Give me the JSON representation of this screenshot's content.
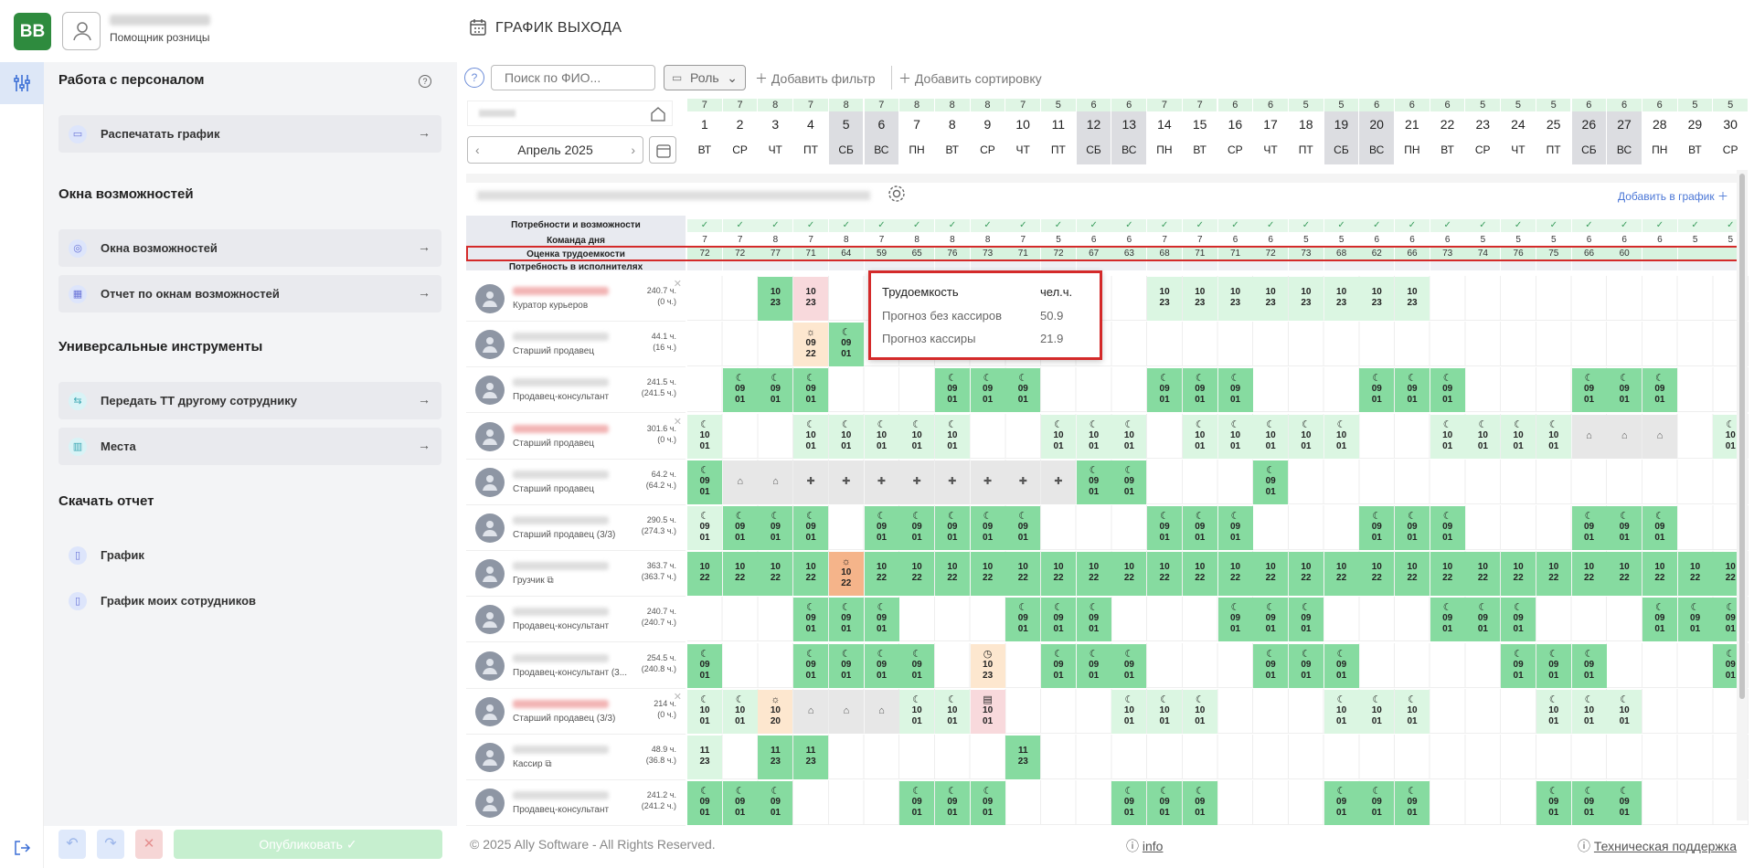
{
  "header": {
    "logo": "BB",
    "user_role": "Помощник розницы",
    "page_title": "ГРАФИК ВЫХОДА"
  },
  "sidebar": {
    "s1_title": "Работа с персоналом",
    "print": "Распечатать график",
    "s2_title": "Окна возможностей",
    "win1": "Окна возможностей",
    "win2": "Отчет по окнам возможностей",
    "s3_title": "Универсальные инструменты",
    "uni1": "Передать ТТ другому сотруднику",
    "uni2": "Места",
    "s4_title": "Скачать отчет",
    "dl1": "График",
    "dl2": "График моих сотрудников"
  },
  "bottom": {
    "publish": "Опубликовать"
  },
  "toolbar": {
    "search_placeholder": "Поиск по ФИО...",
    "role": "Роль",
    "add_filter": "Добавить фильтр",
    "add_sort": "Добавить сортировку"
  },
  "month": "Апрель 2025",
  "add_to_chart": "Добавить в график",
  "days": [
    {
      "n": "1",
      "w": "ВТ",
      "c": "7",
      "we": false,
      "k": "7",
      "e": "72"
    },
    {
      "n": "2",
      "w": "СР",
      "c": "7",
      "we": false,
      "k": "7",
      "e": "72"
    },
    {
      "n": "3",
      "w": "ЧТ",
      "c": "8",
      "we": false,
      "k": "8",
      "e": "77"
    },
    {
      "n": "4",
      "w": "ПТ",
      "c": "7",
      "we": false,
      "k": "7",
      "e": "71"
    },
    {
      "n": "5",
      "w": "СБ",
      "c": "8",
      "we": true,
      "k": "8",
      "e": "64"
    },
    {
      "n": "6",
      "w": "ВС",
      "c": "7",
      "we": true,
      "k": "7",
      "e": "59"
    },
    {
      "n": "7",
      "w": "ПН",
      "c": "8",
      "we": false,
      "k": "8",
      "e": "65"
    },
    {
      "n": "8",
      "w": "ВТ",
      "c": "8",
      "we": false,
      "k": "8",
      "e": "76"
    },
    {
      "n": "9",
      "w": "СР",
      "c": "8",
      "we": false,
      "k": "8",
      "e": "73"
    },
    {
      "n": "10",
      "w": "ЧТ",
      "c": "7",
      "we": false,
      "k": "7",
      "e": "71"
    },
    {
      "n": "11",
      "w": "ПТ",
      "c": "5",
      "we": false,
      "k": "5",
      "e": "72"
    },
    {
      "n": "12",
      "w": "СБ",
      "c": "6",
      "we": true,
      "k": "6",
      "e": "67"
    },
    {
      "n": "13",
      "w": "ВС",
      "c": "6",
      "we": true,
      "k": "6",
      "e": "63"
    },
    {
      "n": "14",
      "w": "ПН",
      "c": "7",
      "we": false,
      "k": "7",
      "e": "68"
    },
    {
      "n": "15",
      "w": "ВТ",
      "c": "7",
      "we": false,
      "k": "7",
      "e": "71"
    },
    {
      "n": "16",
      "w": "СР",
      "c": "6",
      "we": false,
      "k": "6",
      "e": "71"
    },
    {
      "n": "17",
      "w": "ЧТ",
      "c": "6",
      "we": false,
      "k": "6",
      "e": "72"
    },
    {
      "n": "18",
      "w": "ПТ",
      "c": "5",
      "we": false,
      "k": "5",
      "e": "73"
    },
    {
      "n": "19",
      "w": "СБ",
      "c": "5",
      "we": true,
      "k": "5",
      "e": "68"
    },
    {
      "n": "20",
      "w": "ВС",
      "c": "6",
      "we": true,
      "k": "6",
      "e": "62"
    },
    {
      "n": "21",
      "w": "ПН",
      "c": "6",
      "we": false,
      "k": "6",
      "e": "66"
    },
    {
      "n": "22",
      "w": "ВТ",
      "c": "6",
      "we": false,
      "k": "6",
      "e": "73"
    },
    {
      "n": "23",
      "w": "СР",
      "c": "5",
      "we": false,
      "k": "5",
      "e": "74"
    },
    {
      "n": "24",
      "w": "ЧТ",
      "c": "5",
      "we": false,
      "k": "5",
      "e": "76"
    },
    {
      "n": "25",
      "w": "ПТ",
      "c": "5",
      "we": false,
      "k": "5",
      "e": "75"
    },
    {
      "n": "26",
      "w": "СБ",
      "c": "6",
      "we": true,
      "k": "6",
      "e": "66"
    },
    {
      "n": "27",
      "w": "ВС",
      "c": "6",
      "we": true,
      "k": "6",
      "e": "60"
    },
    {
      "n": "28",
      "w": "ПН",
      "c": "6",
      "we": false,
      "k": "6",
      "e": ""
    },
    {
      "n": "29",
      "w": "ВТ",
      "c": "5",
      "we": false,
      "k": "5",
      "e": ""
    },
    {
      "n": "30",
      "w": "СР",
      "c": "5",
      "we": false,
      "k": "5",
      "e": ""
    }
  ],
  "metrics": {
    "needs": "Потребности и возможности",
    "team": "Команда дня",
    "labor": "Оценка трудоемкости",
    "exec": "Потребность в исполнителях",
    "check": "✓"
  },
  "employees": [
    {
      "role": "Куратор курьеров",
      "h1": "240.7 ч.",
      "h2": "(0 ч.)",
      "red": true,
      "x": true
    },
    {
      "role": "Старший продавец",
      "h1": "44.1 ч.",
      "h2": "(16 ч.)",
      "red": false,
      "x": false
    },
    {
      "role": "Продавец-консультант",
      "h1": "241.5 ч.",
      "h2": "(241.5 ч.)",
      "red": false,
      "x": false
    },
    {
      "role": "Старший продавец",
      "h1": "301.6 ч.",
      "h2": "(0 ч.)",
      "red": true,
      "x": true
    },
    {
      "role": "Старший продавец",
      "h1": "64.2 ч.",
      "h2": "(64.2 ч.)",
      "red": false,
      "x": false
    },
    {
      "role": "Старший продавец (3/3)",
      "h1": "290.5 ч.",
      "h2": "(274.3 ч.)",
      "red": false,
      "x": false
    },
    {
      "role": "Грузчик ⧉",
      "h1": "363.7 ч.",
      "h2": "(363.7 ч.)",
      "red": false,
      "x": false
    },
    {
      "role": "Продавец-консультант",
      "h1": "240.7 ч.",
      "h2": "(240.7 ч.)",
      "red": false,
      "x": false
    },
    {
      "role": "Продавец-консультант (3...",
      "h1": "254.5 ч.",
      "h2": "(240.8 ч.)",
      "red": false,
      "x": false
    },
    {
      "role": "Старший продавец (3/3)",
      "h1": "214 ч.",
      "h2": "(0 ч.)",
      "red": true,
      "x": true
    },
    {
      "role": "Кассир ⧉",
      "h1": "48.9 ч.",
      "h2": "(36.8 ч.)",
      "red": false,
      "x": false
    },
    {
      "role": "Продавец-консультант",
      "h1": "241.2 ч.",
      "h2": "(241.2 ч.)",
      "red": false,
      "x": false
    }
  ],
  "schedule": [
    "..,..,g:10|23,pk:10|23,..,..,..,..,..,..,..,..,..,lg:10|23,lg:10|23,lg:10|23,lg:10|23,lg:10|23,lg:10|23,lg:10|23,lg:10|23,..,..,..,..,..,..,..,..,..",
    "..,..,..,pc:☼|09|22,g:☾|09|01,..,..,..,..,..,..,..,..,..,..,..,..,..,..,..,..,..,..,..,..,..,..,..,..,..",
    "..,g:☾|09|01,g:☾|09|01,g:☾|09|01,..,..,..,g:☾|09|01,g:☾|09|01,g:☾|09|01,..,..,..,g:☾|09|01,g:☾|09|01,g:☾|09|01,..,..,..,g:☾|09|01,g:☾|09|01,g:☾|09|01,..,..,..,g:☾|09|01,g:☾|09|01,g:☾|09|01,..,..",
    "lg:☾|10|01,..,..,lg:☾|10|01,lg:☾|10|01,lg:☾|10|01,lg:☾|10|01,lg:☾|10|01,..,..,lg:☾|10|01,lg:☾|10|01,lg:☾|10|01,..,lg:☾|10|01,lg:☾|10|01,lg:☾|10|01,lg:☾|10|01,lg:☾|10|01,..,..,lg:☾|10|01,lg:☾|10|01,lg:☾|10|01,lg:☾|10|01,gr:⌂,gr:⌂,gr:⌂,..,lg:☾|10|01",
    "g:☾|09|01,gr:⌂,gr:⌂,gr:✚,gr:✚,gr:✚,gr:✚,gr:✚,gr:✚,gr:✚,gr:✚,g:☾|09|01,g:☾|09|01,..,..,..,g:☾|09|01,..,..,..,..,..,..,..,..,..,..,..,..,..",
    "lg:☾|09|01,g:☾|09|01,g:☾|09|01,g:☾|09|01,..,g:☾|09|01,g:☾|09|01,g:☾|09|01,g:☾|09|01,g:☾|09|01,..,..,..,g:☾|09|01,g:☾|09|01,g:☾|09|01,..,..,..,g:☾|09|01,g:☾|09|01,g:☾|09|01,..,..,..,g:☾|09|01,g:☾|09|01,g:☾|09|01,..,..",
    "g:10|22,g:10|22,g:10|22,g:10|22,or:☼|10|22,g:10|22,g:10|22,g:10|22,g:10|22,g:10|22,g:10|22,g:10|22,g:10|22,g:10|22,g:10|22,g:10|22,g:10|22,g:10|22,g:10|22,g:10|22,g:10|22,g:10|22,g:10|22,g:10|22,g:10|22,g:10|22,g:10|22,g:10|22,g:10|22,g:10|22",
    "..,..,..,g:☾|09|01,g:☾|09|01,g:☾|09|01,..,..,..,g:☾|09|01,g:☾|09|01,g:☾|09|01,..,..,..,g:☾|09|01,g:☾|09|01,g:☾|09|01,..,..,..,g:☾|09|01,g:☾|09|01,g:☾|09|01,..,..,..,g:☾|09|01,g:☾|09|01,g:☾|09|01",
    "g:☾|09|01,..,..,g:☾|09|01,g:☾|09|01,g:☾|09|01,g:☾|09|01,..,pc:◷|10|23,..,g:☾|09|01,g:☾|09|01,g:☾|09|01,..,..,..,g:☾|09|01,g:☾|09|01,g:☾|09|01,..,..,..,..,g:☾|09|01,g:☾|09|01,g:☾|09|01,..,..,..,g:☾|09|01",
    "lg:☾|10|01,lg:☾|10|01,pc:☼|10|20,gr:⌂,gr:⌂,gr:⌂,lg:☾|10|01,lg:☾|10|01,pk:▤|10|01,..,..,..,lg:☾|10|01,lg:☾|10|01,lg:☾|10|01,..,..,..,lg:☾|10|01,lg:☾|10|01,lg:☾|10|01,..,..,..,lg:☾|10|01,lg:☾|10|01,lg:☾|10|01,..,..,..",
    "lg:11|23,..,g:11|23,g:11|23,..,..,..,..,..,g:11|23,..,..,..,..,..,..,..,..,..,..,..,..,..,..,..,..,..,..,..,..",
    "g:☾|09|01,g:☾|09|01,g:☾|09|01,..,..,..,g:☾|09|01,g:☾|09|01,g:☾|09|01,..,..,..,g:☾|09|01,g:☾|09|01,g:☾|09|01,..,..,..,g:☾|09|01,g:☾|09|01,g:☾|09|01,..,..,..,g:☾|09|01,g:☾|09|01,g:☾|09|01,..,..,.."
  ],
  "tooltip": {
    "title": "Трудоемкость",
    "unit": "чел.ч.",
    "r1": "Прогноз без кассиров",
    "v1": "50.9",
    "r2": "Прогноз кассиры",
    "v2": "21.9"
  },
  "footer": {
    "copy": "© 2025 Ally Software - All Rights Reserved.",
    "info": "info",
    "support": "Техническая поддержка"
  }
}
